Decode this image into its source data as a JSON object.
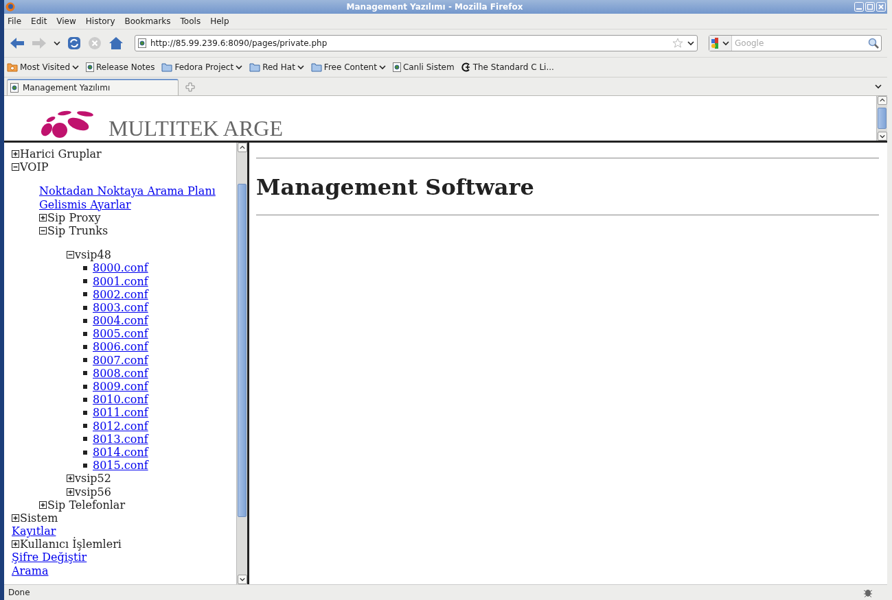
{
  "window": {
    "title": "Management Yazılımı - Mozilla Firefox"
  },
  "menu": [
    "File",
    "Edit",
    "View",
    "History",
    "Bookmarks",
    "Tools",
    "Help"
  ],
  "address_bar": {
    "value": "http://85.99.239.6:8090/pages/private.php"
  },
  "search": {
    "placeholder": "Google"
  },
  "bookmarks": [
    {
      "label": "Most Visited",
      "kind": "smart",
      "dropdown": true
    },
    {
      "label": "Release Notes",
      "kind": "page",
      "dropdown": false
    },
    {
      "label": "Fedora Project",
      "kind": "folder",
      "dropdown": true
    },
    {
      "label": "Red Hat",
      "kind": "folder",
      "dropdown": true
    },
    {
      "label": "Free Content",
      "kind": "folder",
      "dropdown": true
    },
    {
      "label": "Canli Sistem",
      "kind": "page",
      "dropdown": false
    },
    {
      "label": "The Standard C Li...",
      "kind": "cplus",
      "dropdown": false
    }
  ],
  "tabs": [
    {
      "label": "Management Yazılımı",
      "selected": true
    }
  ],
  "header": {
    "logo_text": "MULTITEK ARGE"
  },
  "tree": [
    {
      "label": "Harici Gruplar",
      "kind": "folder",
      "expanded": false
    },
    {
      "label": "VOIP",
      "kind": "folder",
      "expanded": true,
      "children": [
        {
          "label": "Noktadan Noktaya Arama Planı",
          "kind": "link"
        },
        {
          "label": "Gelismis Ayarlar",
          "kind": "link"
        },
        {
          "label": "Sip Proxy",
          "kind": "folder",
          "expanded": false
        },
        {
          "label": "Sip Trunks",
          "kind": "folder",
          "expanded": true,
          "children": [
            {
              "label": "vsip48",
              "kind": "folder",
              "expanded": true,
              "children": [
                {
                  "label": "8000.conf",
                  "kind": "file"
                },
                {
                  "label": "8001.conf",
                  "kind": "file"
                },
                {
                  "label": "8002.conf",
                  "kind": "file"
                },
                {
                  "label": "8003.conf",
                  "kind": "file"
                },
                {
                  "label": "8004.conf",
                  "kind": "file"
                },
                {
                  "label": "8005.conf",
                  "kind": "file"
                },
                {
                  "label": "8006.conf",
                  "kind": "file"
                },
                {
                  "label": "8007.conf",
                  "kind": "file"
                },
                {
                  "label": "8008.conf",
                  "kind": "file"
                },
                {
                  "label": "8009.conf",
                  "kind": "file"
                },
                {
                  "label": "8010.conf",
                  "kind": "file"
                },
                {
                  "label": "8011.conf",
                  "kind": "file"
                },
                {
                  "label": "8012.conf",
                  "kind": "file"
                },
                {
                  "label": "8013.conf",
                  "kind": "file"
                },
                {
                  "label": "8014.conf",
                  "kind": "file"
                },
                {
                  "label": "8015.conf",
                  "kind": "file"
                }
              ]
            },
            {
              "label": "vsip52",
              "kind": "folder",
              "expanded": false
            },
            {
              "label": "vsip56",
              "kind": "folder",
              "expanded": false
            }
          ]
        },
        {
          "label": "Sip Telefonlar",
          "kind": "folder",
          "expanded": false
        }
      ]
    },
    {
      "label": "Sistem",
      "kind": "folder",
      "expanded": false
    },
    {
      "label": "Kayıtlar",
      "kind": "link"
    },
    {
      "label": "Kullanıcı İşlemleri",
      "kind": "folder",
      "expanded": false
    },
    {
      "label": "Şifre Değiştir",
      "kind": "link"
    },
    {
      "label": "Arama",
      "kind": "link"
    }
  ],
  "main": {
    "heading": "Management Software"
  },
  "status_bar": {
    "text": "Done"
  }
}
